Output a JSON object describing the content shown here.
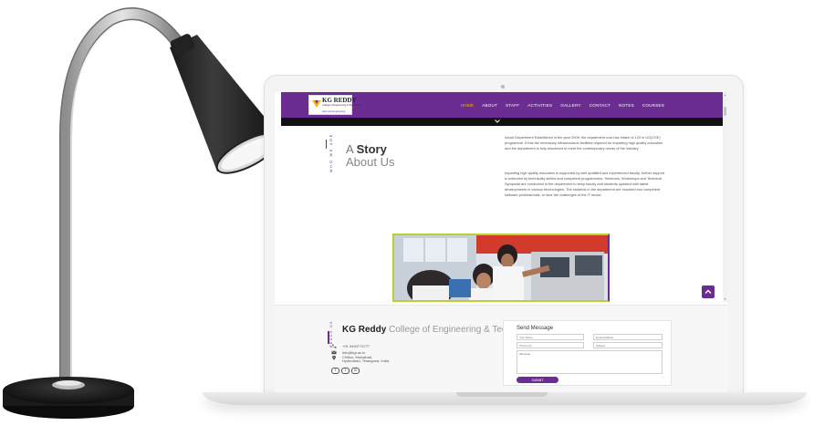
{
  "navbar": {
    "logo": {
      "name": "KG REDDY",
      "subtitle": "College of Engineering & Technology",
      "tagline": "Here Say Engineering"
    },
    "items": [
      {
        "label": "HOME",
        "active": true
      },
      {
        "label": "ABOUT",
        "active": false
      },
      {
        "label": "STAFF",
        "active": false
      },
      {
        "label": "ACTIVITIES",
        "active": false
      },
      {
        "label": "GALLERY",
        "active": false
      },
      {
        "label": "CONTACT",
        "active": false
      },
      {
        "label": "NOTES",
        "active": false
      },
      {
        "label": "COURSES",
        "active": false
      }
    ]
  },
  "story": {
    "eyebrow": "WHO WE ARE",
    "heading_prefix": "A ",
    "heading_bold": "Story",
    "heading_line2": "About Us",
    "paragraph1": "About Department Established in the year 2008, the department now has intake of 120 in UG(CSE) programme. It has the necessary infrastructural facilities required for imparting high quality education and the department is fully structured to meet the contemporary needs of the industry.",
    "paragraph2": "Imparting high quality education is supported by well qualified and experienced faculty, further support is extended by technically skilled and competent programmers. Seminars, Workshops and Technical Symposia are conducted in the department to keep faculty and students updated with latest developments in various technologies. The students in the department are moulded into competent software professionals, to face the challenges of the IT sector."
  },
  "footer": {
    "eyebrow": "REACH US",
    "college_bold": "KG Reddy",
    "college_rest": " College of Engineering & Technology",
    "phone": "+91 9490773777",
    "email": "info@kgr.ac.in",
    "address_line1": "Chilkur, Moinabad,",
    "address_line2": "Hyderabad, Telangana, India",
    "social": [
      "f",
      "t",
      "in"
    ],
    "form": {
      "title": "Send Message",
      "name_placeholder": "Your Name",
      "email_placeholder": "Email Address",
      "phone_placeholder": "Phone No.",
      "subject_placeholder": "Subject",
      "message_placeholder": "Message",
      "submit_label": "SUBMIT"
    }
  },
  "colors": {
    "brand": "#6b2d91",
    "nav_active": "#f5b21e",
    "photo_border": "#b5d335"
  },
  "icons": [
    "lamp-illustration",
    "chevron-down-icon",
    "arrow-up-icon",
    "phone-icon",
    "email-icon",
    "location-icon"
  ]
}
